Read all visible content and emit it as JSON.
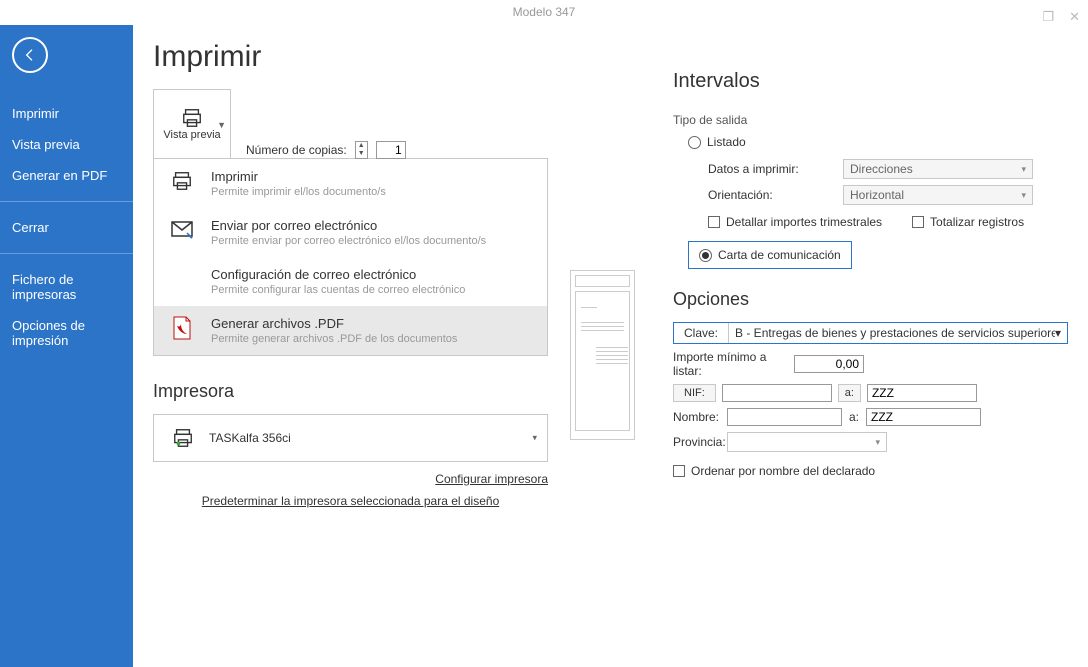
{
  "window_title": "Modelo 347",
  "sidebar": {
    "items": [
      "Imprimir",
      "Vista previa",
      "Generar en PDF",
      "Cerrar",
      "Fichero de impresoras",
      "Opciones de impresión"
    ]
  },
  "page": {
    "title": "Imprimir",
    "vista_previa_label": "Vista previa",
    "copies_label": "Número de copias:",
    "copies_value": "1"
  },
  "dropdown": [
    {
      "title": "Imprimir",
      "desc": "Permite imprimir el/los documento/s"
    },
    {
      "title": "Enviar por correo electrónico",
      "desc": "Permite enviar por correo electrónico el/los documento/s"
    },
    {
      "title": "Configuración de correo electrónico",
      "desc": "Permite configurar las cuentas de correo electrónico"
    },
    {
      "title": "Generar archivos .PDF",
      "desc": "Permite generar archivos .PDF de los documentos"
    }
  ],
  "printer_section": {
    "heading": "Impresora",
    "name": "TASKalfa 356ci",
    "config_link": "Configurar impresora",
    "default_link": "Predeterminar la impresora seleccionada para el diseño"
  },
  "intervalos": {
    "heading": "Intervalos",
    "tipo_salida": "Tipo de salida",
    "listado": "Listado",
    "datos_label": "Datos a imprimir:",
    "datos_value": "Direcciones",
    "orient_label": "Orientación:",
    "orient_value": "Horizontal",
    "detallar": "Detallar importes trimestrales",
    "totalizar": "Totalizar registros",
    "carta": "Carta de comunicación"
  },
  "opciones": {
    "heading": "Opciones",
    "clave_label": "Clave:",
    "clave_value": "B - Entregas de bienes y prestaciones de servicios superiores",
    "importe_label": "Importe mínimo a listar:",
    "importe_value": "0,00",
    "nif_label": "NIF:",
    "a_label": "a:",
    "nif_to": "ZZZ",
    "nombre_label": "Nombre:",
    "nombre_to": "ZZZ",
    "provincia_label": "Provincia:",
    "ordenar": "Ordenar por nombre del declarado"
  }
}
